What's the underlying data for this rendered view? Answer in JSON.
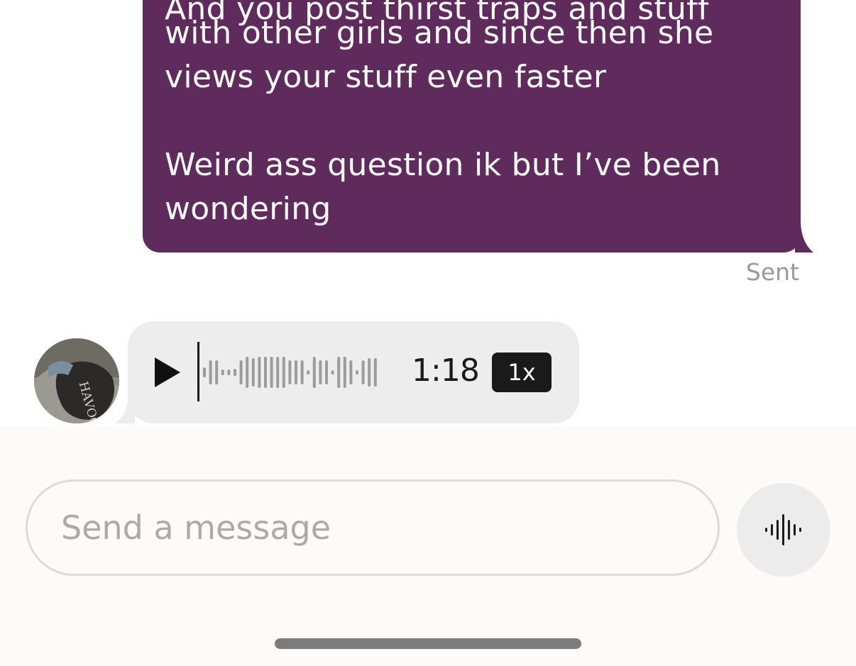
{
  "outgoing_message": {
    "lines": [
      "And you post thirst traps and stuff",
      "with other girls and since then she",
      "views your stuff even faster",
      "",
      "Weird ass question ik but I’ve been",
      "wondering"
    ],
    "status": "Sent",
    "bubble_color": "#5e2b5c"
  },
  "voice_message": {
    "avatar": "avatar-photo-icon",
    "play_icon": "play-icon",
    "duration": "1:18",
    "speed": "1x",
    "bubble_color": "#ededed"
  },
  "composer": {
    "placeholder": "Send a message",
    "value": "",
    "voice_button_icon": "audio-waveform-icon"
  }
}
